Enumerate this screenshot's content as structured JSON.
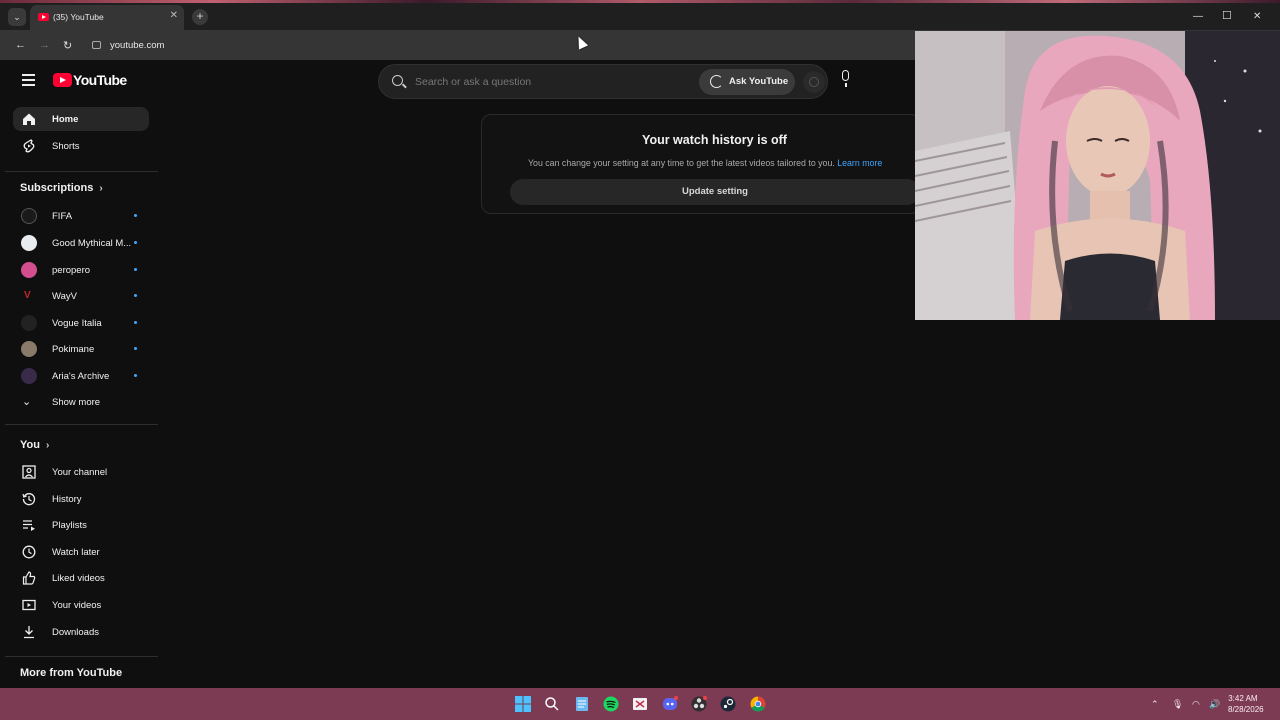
{
  "browser": {
    "tab_title": "(35) YouTube",
    "new_tab": "+",
    "url": "youtube.com"
  },
  "header": {
    "logo_text": "YouTube",
    "search_placeholder": "Search or ask a question",
    "ask_label": "Ask YouTube"
  },
  "sidebar": {
    "primary": [
      {
        "label": "Home",
        "icon": "home-icon"
      },
      {
        "label": "Shorts",
        "icon": "shorts-icon"
      }
    ],
    "subscriptions_title": "Subscriptions",
    "subscriptions": [
      {
        "label": "FIFA",
        "color": "#1a1a1a"
      },
      {
        "label": "Good Mythical M...",
        "color": "#e8ecef"
      },
      {
        "label": "peropero",
        "color": "#d24e8f"
      },
      {
        "label": "WayV",
        "color": "#8b1d1d"
      },
      {
        "label": "Vogue Italia",
        "color": "#222222"
      },
      {
        "label": "Pokimane",
        "color": "#8a7a6a"
      },
      {
        "label": "Aria's Archive",
        "color": "#3a2a4a"
      }
    ],
    "show_more": "Show more",
    "you_title": "You",
    "you_items": [
      {
        "label": "Your channel",
        "icon": "your-channel-icon"
      },
      {
        "label": "History",
        "icon": "history-icon"
      },
      {
        "label": "Playlists",
        "icon": "playlists-icon"
      },
      {
        "label": "Watch later",
        "icon": "watch-later-icon"
      },
      {
        "label": "Liked videos",
        "icon": "like-icon"
      },
      {
        "label": "Your videos",
        "icon": "your-videos-icon"
      },
      {
        "label": "Downloads",
        "icon": "download-icon"
      }
    ],
    "more_title": "More from YouTube"
  },
  "notice": {
    "title": "Your watch history is off",
    "text": "You can change your setting at any time to get the latest videos tailored to you.",
    "link": "Learn more",
    "button": "Update setting"
  },
  "taskbar": {
    "time": "3:42 AM",
    "date": "8/28/2026",
    "accent": "#7d3a53"
  }
}
